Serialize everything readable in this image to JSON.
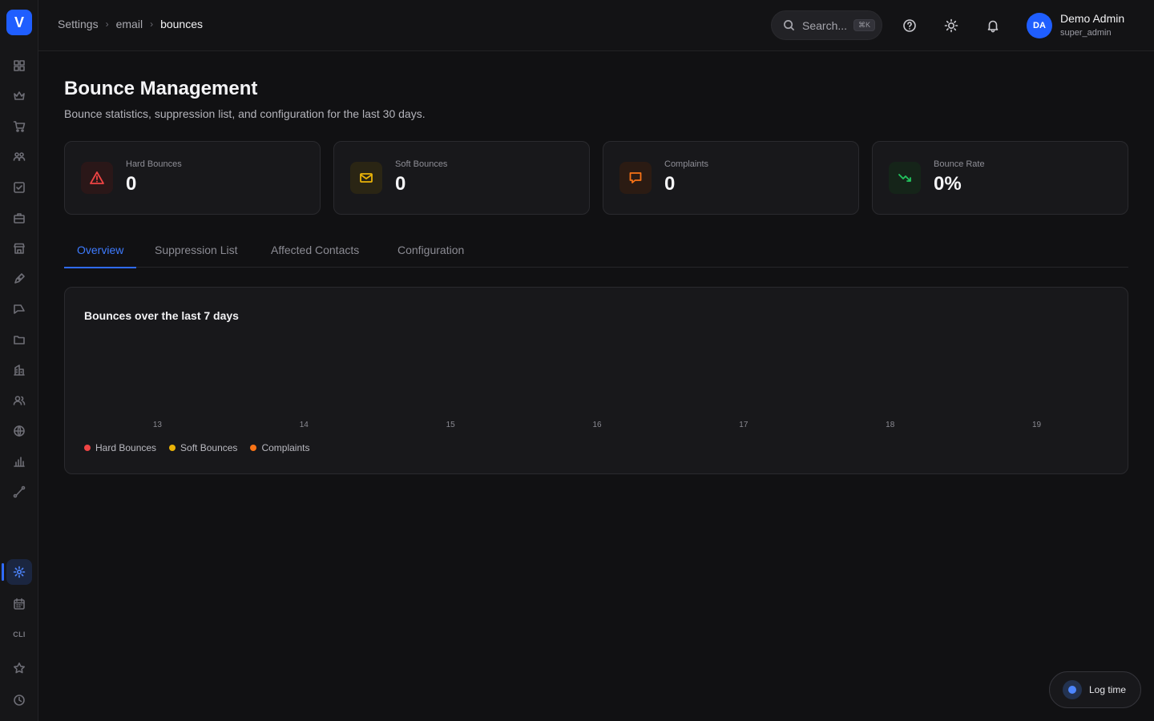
{
  "app": {
    "logo_letter": "V"
  },
  "sidebar": {
    "items": [
      {
        "icon": "grid-icon"
      },
      {
        "icon": "crown-icon"
      },
      {
        "icon": "cart-icon"
      },
      {
        "icon": "users-icon"
      },
      {
        "icon": "checkbox-icon"
      },
      {
        "icon": "briefcase-icon"
      },
      {
        "icon": "store-icon"
      },
      {
        "icon": "pen-icon"
      },
      {
        "icon": "send-icon"
      },
      {
        "icon": "folder-icon"
      },
      {
        "icon": "building-icon"
      },
      {
        "icon": "team-icon"
      },
      {
        "icon": "globe-icon"
      },
      {
        "icon": "bar-chart-icon"
      },
      {
        "icon": "route-icon"
      }
    ],
    "bottom": [
      {
        "icon": "settings-icon",
        "active": true
      },
      {
        "icon": "calendar-icon"
      },
      {
        "icon": "cli-text",
        "label": "CLI"
      },
      {
        "icon": "star-icon"
      },
      {
        "icon": "clock-icon"
      }
    ]
  },
  "header": {
    "breadcrumb": [
      "Settings",
      "email",
      "bounces"
    ],
    "search": {
      "placeholder": "Search...",
      "shortcut": "⌘K"
    },
    "user": {
      "initials": "DA",
      "name": "Demo Admin",
      "role": "super_admin"
    }
  },
  "page": {
    "title": "Bounce Management",
    "subtitle": "Bounce statistics, suppression list, and configuration for the last 30 days."
  },
  "stats": [
    {
      "label": "Hard Bounces",
      "value": "0",
      "color": "#ef4444",
      "icon": "alert-triangle-icon"
    },
    {
      "label": "Soft Bounces",
      "value": "0",
      "color": "#eab308",
      "icon": "mail-icon"
    },
    {
      "label": "Complaints",
      "value": "0",
      "color": "#f97316",
      "icon": "message-square-icon"
    },
    {
      "label": "Bounce Rate",
      "value": "0%",
      "color": "#22c55e",
      "icon": "trending-down-icon"
    }
  ],
  "tabs": [
    {
      "label": "Overview",
      "active": true
    },
    {
      "label": "Suppression List"
    },
    {
      "label": "Affected Contacts"
    },
    {
      "label": "Configuration"
    }
  ],
  "chart_data": {
    "type": "bar",
    "title": "Bounces over the last 7 days",
    "categories": [
      "13",
      "14",
      "15",
      "16",
      "17",
      "18",
      "19"
    ],
    "series": [
      {
        "name": "Hard Bounces",
        "color": "#ef4444",
        "values": [
          0,
          0,
          0,
          0,
          0,
          0,
          0
        ]
      },
      {
        "name": "Soft Bounces",
        "color": "#eab308",
        "values": [
          0,
          0,
          0,
          0,
          0,
          0,
          0
        ]
      },
      {
        "name": "Complaints",
        "color": "#f97316",
        "values": [
          0,
          0,
          0,
          0,
          0,
          0,
          0
        ]
      }
    ],
    "grid": false,
    "legend": "bottom-left"
  },
  "log_time": {
    "label": "Log time"
  }
}
